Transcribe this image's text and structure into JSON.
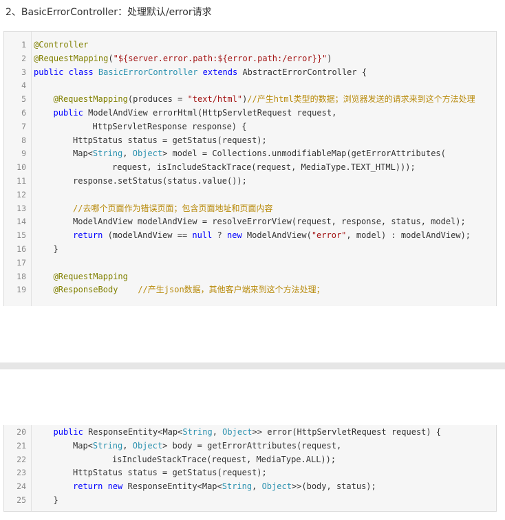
{
  "heading": "2、BasicErrorController：处理默认/error请求",
  "code_top": [
    {
      "n": "1",
      "indent": 0,
      "tokens": [
        {
          "c": "ann",
          "t": "@Controller"
        }
      ]
    },
    {
      "n": "2",
      "indent": 0,
      "tokens": [
        {
          "c": "ann",
          "t": "@RequestMapping"
        },
        {
          "c": "pln",
          "t": "("
        },
        {
          "c": "str",
          "t": "\"${server.error.path:${error.path:/error}}\""
        },
        {
          "c": "pln",
          "t": ")"
        }
      ]
    },
    {
      "n": "3",
      "indent": 0,
      "tokens": [
        {
          "c": "kw",
          "t": "public class "
        },
        {
          "c": "cls",
          "t": "BasicErrorController"
        },
        {
          "c": "kw",
          "t": " extends "
        },
        {
          "c": "pln",
          "t": "AbstractErrorController {"
        }
      ]
    },
    {
      "n": "4",
      "indent": 0,
      "tokens": []
    },
    {
      "n": "5",
      "indent": 1,
      "tokens": [
        {
          "c": "ann",
          "t": "@RequestMapping"
        },
        {
          "c": "pln",
          "t": "(produces = "
        },
        {
          "c": "str",
          "t": "\"text/html\""
        },
        {
          "c": "pln",
          "t": ")"
        },
        {
          "c": "cmt",
          "t": "//产生html类型的数据；浏览器发送的请求来到这个方法处理"
        }
      ]
    },
    {
      "n": "6",
      "indent": 1,
      "tokens": [
        {
          "c": "kw",
          "t": "public "
        },
        {
          "c": "pln",
          "t": "ModelAndView errorHtml(HttpServletRequest request,"
        }
      ]
    },
    {
      "n": "7",
      "indent": 3,
      "tokens": [
        {
          "c": "pln",
          "t": "HttpServletResponse response) {"
        }
      ]
    },
    {
      "n": "8",
      "indent": 2,
      "tokens": [
        {
          "c": "pln",
          "t": "HttpStatus status = getStatus(request);"
        }
      ]
    },
    {
      "n": "9",
      "indent": 2,
      "tokens": [
        {
          "c": "pln",
          "t": "Map<"
        },
        {
          "c": "cls",
          "t": "String"
        },
        {
          "c": "pln",
          "t": ", "
        },
        {
          "c": "cls",
          "t": "Object"
        },
        {
          "c": "pln",
          "t": "> model = Collections.unmodifiableMap(getErrorAttributes("
        }
      ]
    },
    {
      "n": "10",
      "indent": 4,
      "tokens": [
        {
          "c": "pln",
          "t": "request, isIncludeStackTrace(request, MediaType.TEXT_HTML)));"
        }
      ]
    },
    {
      "n": "11",
      "indent": 2,
      "tokens": [
        {
          "c": "pln",
          "t": "response.setStatus(status.value());"
        }
      ]
    },
    {
      "n": "12",
      "indent": 0,
      "tokens": []
    },
    {
      "n": "13",
      "indent": 2,
      "tokens": [
        {
          "c": "cmt",
          "t": "//去哪个页面作为错误页面；包含页面地址和页面内容"
        }
      ]
    },
    {
      "n": "14",
      "indent": 2,
      "tokens": [
        {
          "c": "pln",
          "t": "ModelAndView modelAndView = resolveErrorView(request, response, status, model);"
        }
      ]
    },
    {
      "n": "15",
      "indent": 2,
      "tokens": [
        {
          "c": "kw",
          "t": "return "
        },
        {
          "c": "pln",
          "t": "(modelAndView == "
        },
        {
          "c": "kw",
          "t": "null"
        },
        {
          "c": "pln",
          "t": " ? "
        },
        {
          "c": "kw",
          "t": "new "
        },
        {
          "c": "pln",
          "t": "ModelAndView("
        },
        {
          "c": "str",
          "t": "\"error\""
        },
        {
          "c": "pln",
          "t": ", model) : modelAndView);"
        }
      ]
    },
    {
      "n": "16",
      "indent": 1,
      "tokens": [
        {
          "c": "pln",
          "t": "}"
        }
      ]
    },
    {
      "n": "17",
      "indent": 0,
      "tokens": []
    },
    {
      "n": "18",
      "indent": 1,
      "tokens": [
        {
          "c": "ann",
          "t": "@RequestMapping"
        }
      ]
    },
    {
      "n": "19",
      "indent": 1,
      "tokens": [
        {
          "c": "ann",
          "t": "@ResponseBody"
        },
        {
          "c": "pln",
          "t": "    "
        },
        {
          "c": "cmt",
          "t": "//产生json数据，其他客户端来到这个方法处理；"
        }
      ]
    }
  ],
  "code_bottom": [
    {
      "n": "20",
      "indent": 1,
      "tokens": [
        {
          "c": "kw",
          "t": "public "
        },
        {
          "c": "pln",
          "t": "ResponseEntity<Map<"
        },
        {
          "c": "cls",
          "t": "String"
        },
        {
          "c": "pln",
          "t": ", "
        },
        {
          "c": "cls",
          "t": "Object"
        },
        {
          "c": "pln",
          "t": ">> error(HttpServletRequest request) {"
        }
      ]
    },
    {
      "n": "21",
      "indent": 2,
      "tokens": [
        {
          "c": "pln",
          "t": "Map<"
        },
        {
          "c": "cls",
          "t": "String"
        },
        {
          "c": "pln",
          "t": ", "
        },
        {
          "c": "cls",
          "t": "Object"
        },
        {
          "c": "pln",
          "t": "> body = getErrorAttributes(request,"
        }
      ]
    },
    {
      "n": "22",
      "indent": 4,
      "tokens": [
        {
          "c": "pln",
          "t": "isIncludeStackTrace(request, MediaType.ALL));"
        }
      ]
    },
    {
      "n": "23",
      "indent": 2,
      "tokens": [
        {
          "c": "pln",
          "t": "HttpStatus status = getStatus(request);"
        }
      ]
    },
    {
      "n": "24",
      "indent": 2,
      "tokens": [
        {
          "c": "kw",
          "t": "return new "
        },
        {
          "c": "pln",
          "t": "ResponseEntity<Map<"
        },
        {
          "c": "cls",
          "t": "String"
        },
        {
          "c": "pln",
          "t": ", "
        },
        {
          "c": "cls",
          "t": "Object"
        },
        {
          "c": "pln",
          "t": ">>(body, status);"
        }
      ]
    },
    {
      "n": "25",
      "indent": 1,
      "tokens": [
        {
          "c": "pln",
          "t": "}"
        }
      ]
    }
  ]
}
